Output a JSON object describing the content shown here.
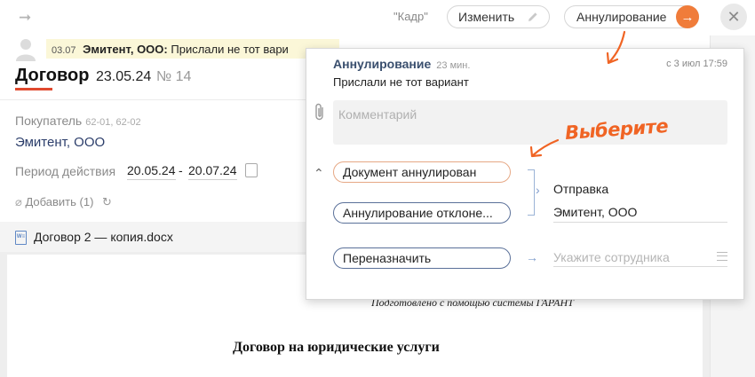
{
  "topbar": {
    "arrow_icon": "arrow-right-icon",
    "source_label": "\"Кадр\"",
    "change_label": "Изменить",
    "annul_label": "Аннулирование"
  },
  "message": {
    "date": "03.07",
    "author": "Эмитент, ООО:",
    "text": "Прислали не тот вари"
  },
  "document": {
    "title": "Договор",
    "date": "23.05.24",
    "number": "№ 14",
    "buyer_label": "Покупатель",
    "buyer_codes": "62-01, 62-02",
    "buyer_value": "Эмитент, ООО",
    "period_label": "Период действия",
    "period_from": "20.05.24",
    "period_dash": "-",
    "period_to": "20.07.24",
    "add_label": "Добавить (1)",
    "file_name": "Договор 2 — копия.docx",
    "file_icon_text": "W≡",
    "garant_text": "Подготовлено с помощью системы ГАРАНТ",
    "heading": "Договор на юридические услуги"
  },
  "popup": {
    "title": "Аннулирование",
    "time_ago": "23 мин.",
    "date": "с 3 июл 17:59",
    "message": "Прислали не тот вариант",
    "comment_placeholder": "Комментарий",
    "option_1": "Документ аннулирован",
    "option_2": "Аннулирование отклоне...",
    "option_3": "Переназначить",
    "send_label": "Отправка",
    "send_value": "Эмитент, ООО",
    "assignee_placeholder": "Укажите сотрудника"
  },
  "annotation": {
    "text": "Выберите",
    "color": "#f06424"
  },
  "colors": {
    "accent_orange": "#f07c3a",
    "title_underline": "#e0492e",
    "link_blue": "#2c3e6b",
    "highlight": "#fbf7d8"
  }
}
